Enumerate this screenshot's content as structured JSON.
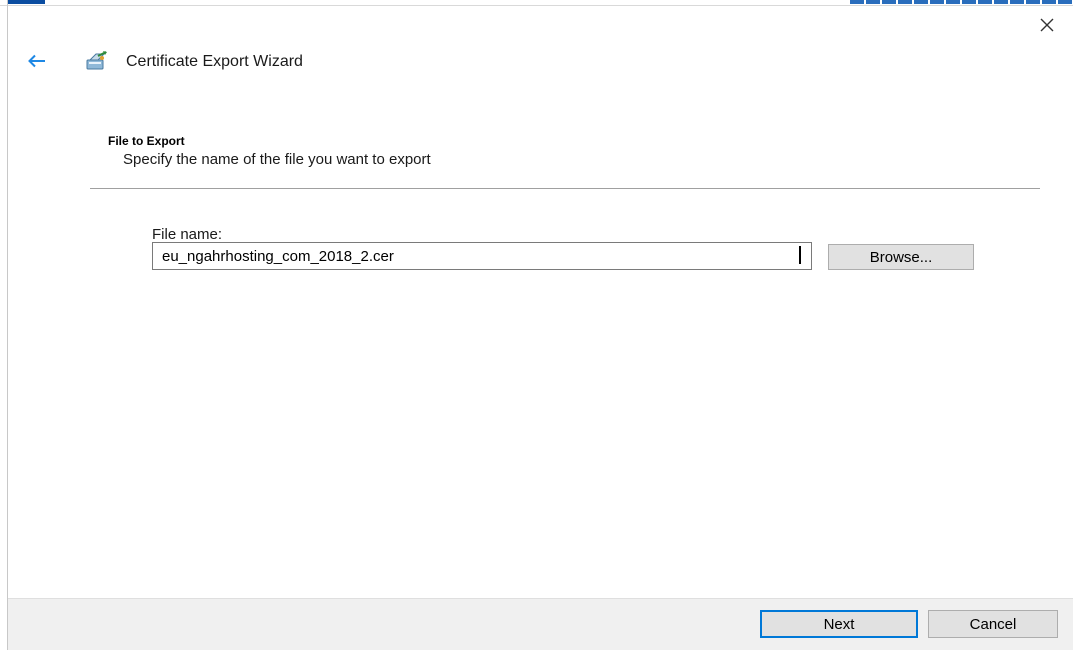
{
  "window": {
    "title": "Certificate Export Wizard",
    "close_icon": "close-icon",
    "back_icon": "back-arrow-icon",
    "wizard_icon": "certificate-wizard-icon",
    "accent_color": "#0078d7"
  },
  "page": {
    "section_title": "File to Export",
    "section_subtitle": "Specify the name of the file you want to export"
  },
  "file": {
    "label": "File name:",
    "value": "eu_ngahrhosting_com_2018_2.cer",
    "browse_label": "Browse..."
  },
  "footer": {
    "next_label": "Next",
    "cancel_label": "Cancel"
  }
}
